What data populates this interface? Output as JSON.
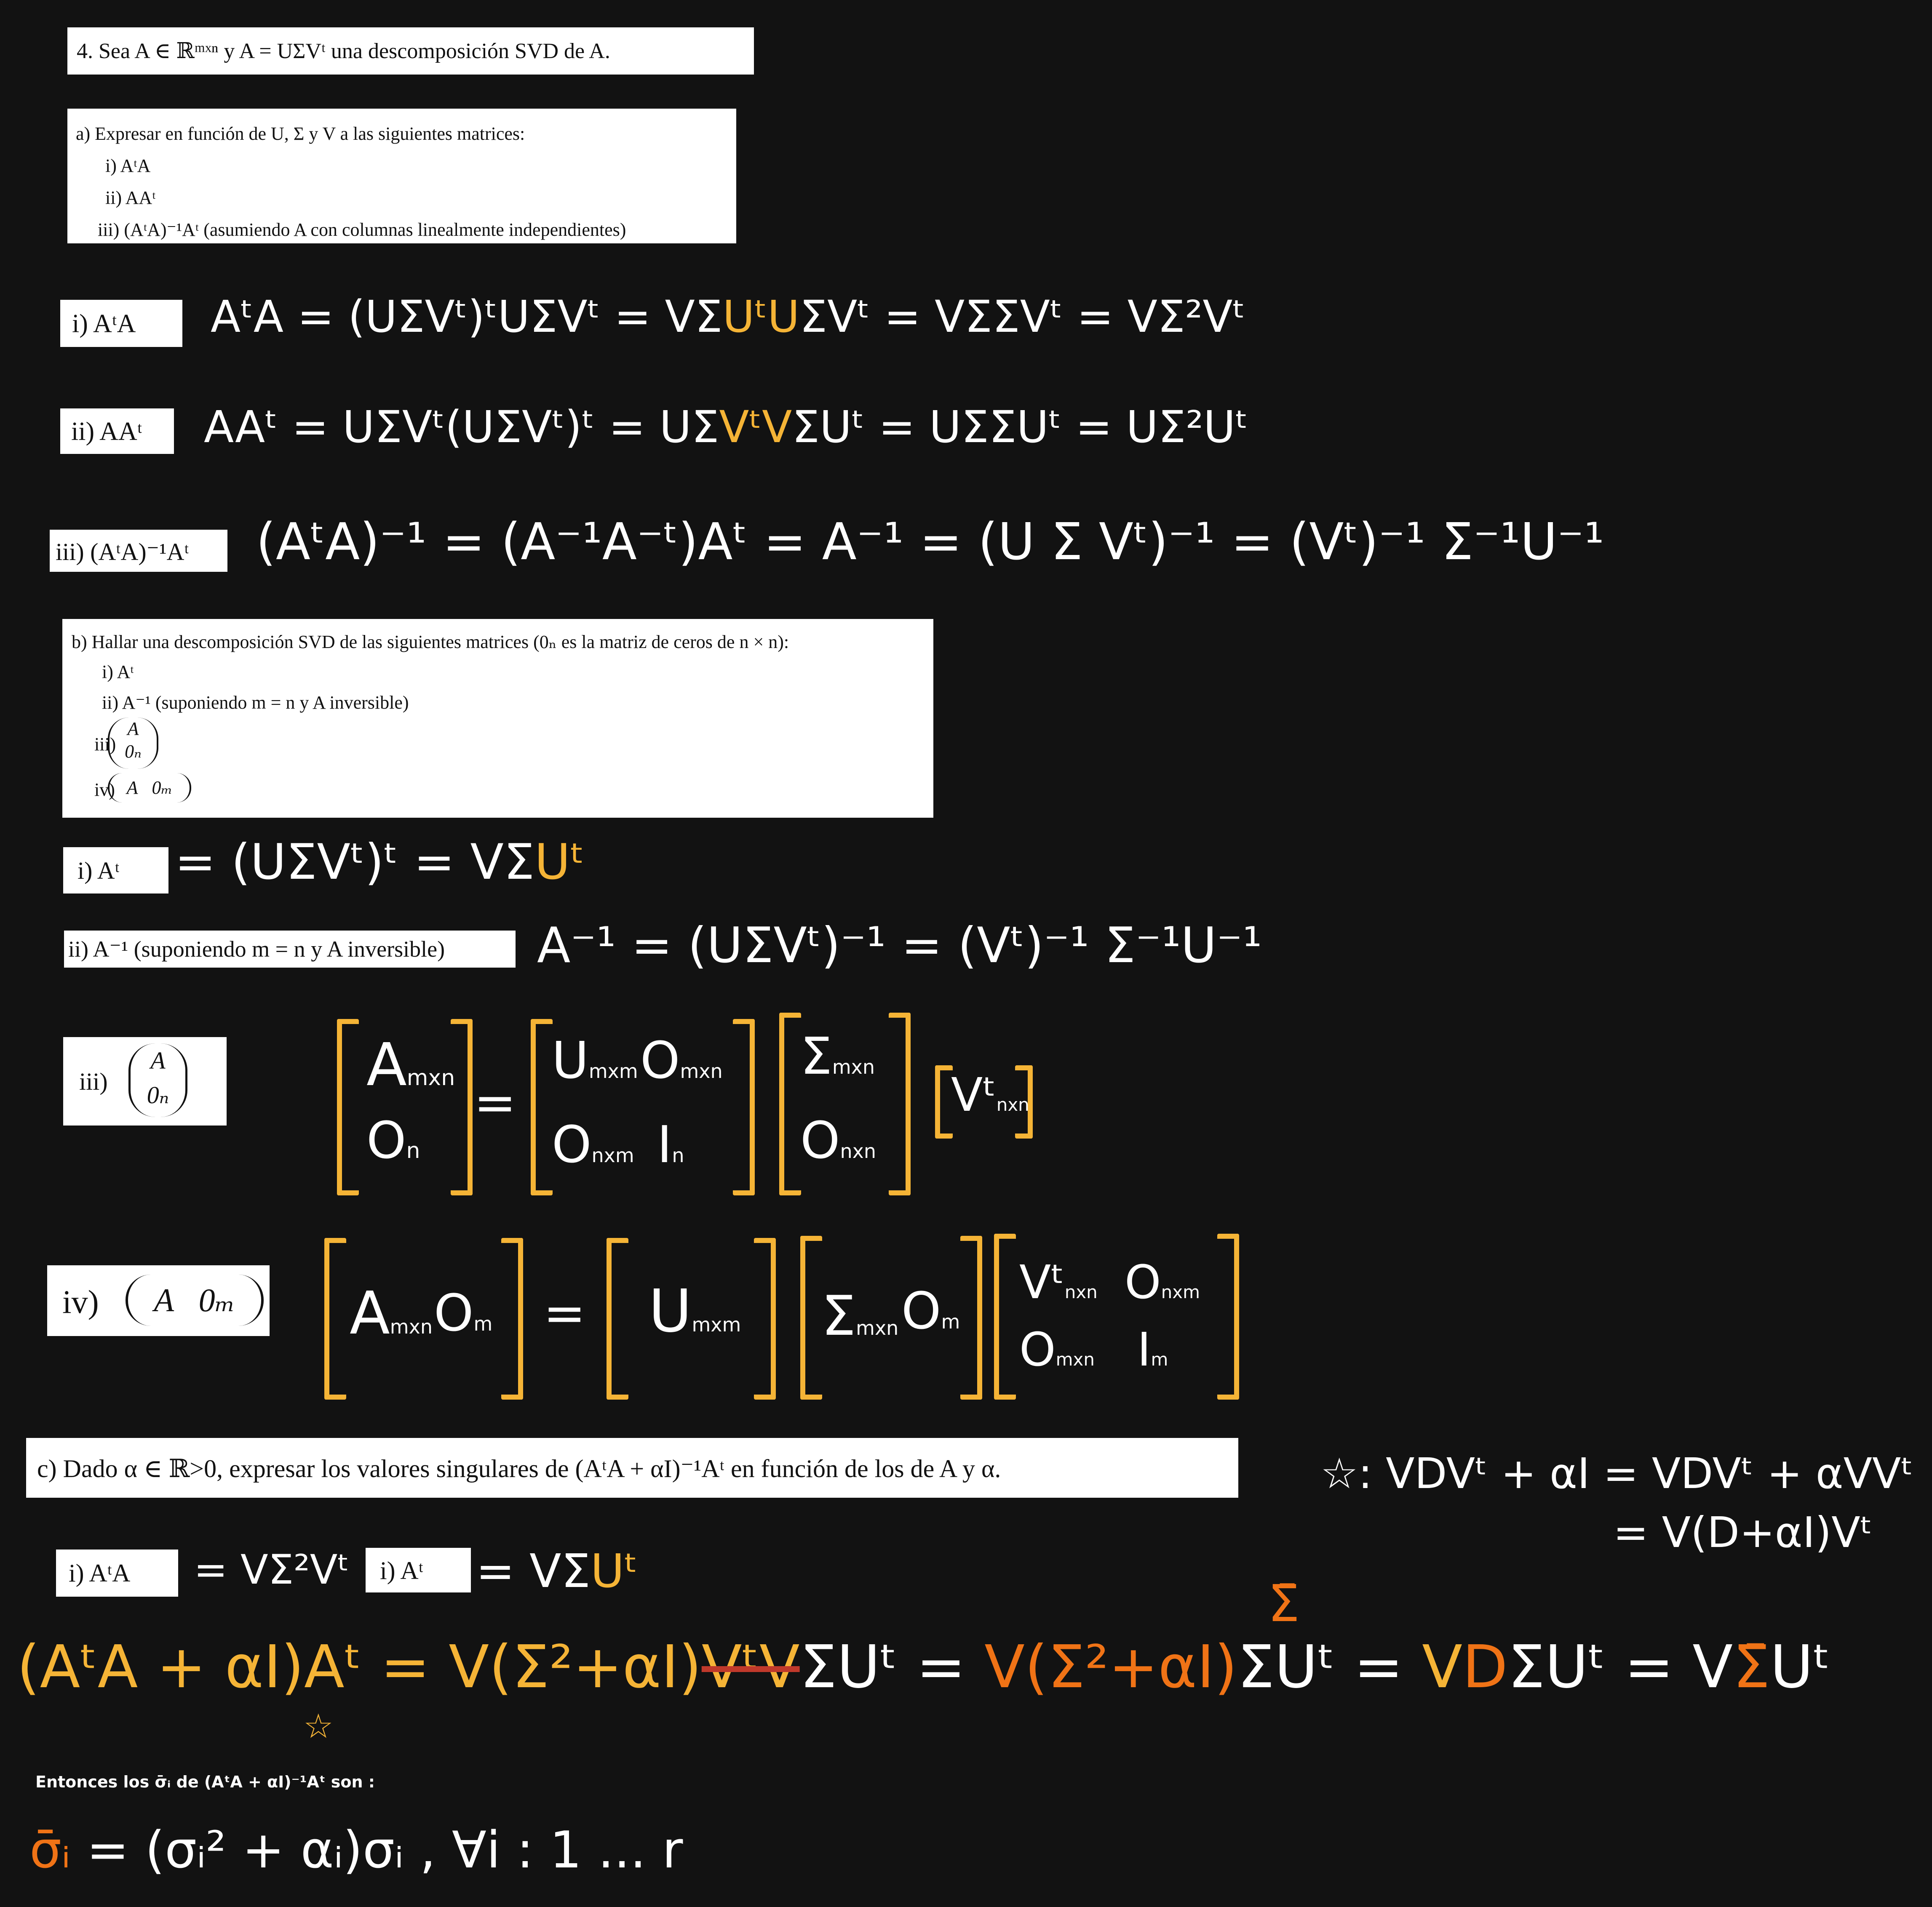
{
  "header": {
    "text": "4.  Sea A ∈ ℝᵐˣⁿ y A = UΣVᵗ una descomposición SVD de A."
  },
  "part_a": {
    "prompt": "a)  Expresar en función de U, Σ y V a las siguientes matrices:",
    "items": [
      "i)  AᵗA",
      "ii)  AAᵗ",
      "iii)  (AᵗA)⁻¹Aᵗ (asumiendo A con columnas linealmente independientes)"
    ],
    "labels": [
      "i)  AᵗA",
      "ii)  AAᵗ",
      "iii)  (AᵗA)⁻¹Aᵗ"
    ],
    "answers": {
      "i": [
        "AᵗA = (UΣVᵗ)ᵗUΣVᵗ = VΣ",
        "UᵗU",
        "ΣVᵗ = VΣΣVᵗ = VΣ²Vᵗ"
      ],
      "ii": [
        "AAᵗ = UΣVᵗ(UΣVᵗ)ᵗ = UΣ",
        "VᵗV",
        "ΣUᵗ = UΣΣUᵗ = UΣ²Uᵗ"
      ],
      "iii": "(AᵗA)⁻¹ = (A⁻¹A⁻ᵗ)Aᵗ = A⁻¹ = (U Σ Vᵗ)⁻¹ =  (Vᵗ)⁻¹ Σ⁻¹U⁻¹"
    }
  },
  "part_b": {
    "prompt": "b)  Hallar una descomposición SVD de las siguientes matrices (0ₙ es la matriz de ceros de n × n):",
    "items": [
      "i)  Aᵗ",
      "ii)  A⁻¹ (suponiendo m = n y A inversible)",
      "iii)",
      "iv)"
    ],
    "stack_top": "A",
    "stack_bottom": "0ₙ",
    "row_left": "A",
    "row_right": "0ₘ",
    "labels": [
      "i)  Aᵗ",
      "ii)  A⁻¹ (suponiendo m = n y A inversible)",
      "iii)",
      "iv)"
    ],
    "answers": {
      "i": [
        "= (UΣVᵗ)ᵗ = VΣ",
        "Uᵗ"
      ],
      "ii": "A⁻¹ = (UΣVᵗ)⁻¹ = (Vᵗ)⁻¹ Σ⁻¹U⁻¹",
      "iii": {
        "lhs_top": "A",
        "lhs_top_sub": "mxn",
        "lhs_bottom": "O",
        "lhs_bottom_sub": "n",
        "eq": "=",
        "u_tl": "U",
        "u_tl_sub": "mxm",
        "u_tr": "O",
        "u_tr_sub": "mxn",
        "u_bl": "O",
        "u_bl_sub": "nxm",
        "u_br": "I",
        "u_br_sub": "n",
        "s_top": "Σ",
        "s_top_sub": "mxn",
        "s_bottom": "O",
        "s_bottom_sub": "nxn",
        "v": "Vᵗ",
        "v_sub": "nxn"
      },
      "iv": {
        "lhs_a": "A",
        "lhs_a_sub": "mxn",
        "lhs_o": "O",
        "lhs_o_sub": "m",
        "eq": "=",
        "u": "U",
        "u_sub": "mxm",
        "s": "Σ",
        "s_sub": "mxn",
        "s_o": "O",
        "s_o_sub": "m",
        "v_tl": "Vᵗ",
        "v_tl_sub": "nxn",
        "v_tr": "O",
        "v_tr_sub": "nxm",
        "v_bl": "O",
        "v_bl_sub": "mxn",
        "v_br": "I",
        "v_br_sub": "m"
      }
    }
  },
  "part_c": {
    "prompt": "c)  Dado α ∈ ℝ>0, expresar los valores singulares de (AᵗA + αI)⁻¹Aᵗ en función de los de A y α.",
    "label_1": "i)  AᵗA",
    "label_2": "i)  Aᵗ",
    "ref_1": "= VΣ²Vᵗ",
    "ref_2a": "= VΣ",
    "ref_2b": "Uᵗ",
    "star_note_1": "☆:  VDVᵗ + αI = VDVᵗ + αVVᵗ",
    "star_note_2": "= V(D+αI)Vᵗ",
    "sigma_bar": "Σ̄",
    "main_lhs": "(AᵗA + αI)Aᵗ =",
    "main_1": "V(Σ²+αI)",
    "main_2": "VᵗV",
    "main_3": "ΣUᵗ  =",
    "main_4": "V(Σ²+αI)",
    "main_5": "ΣUᵗ =",
    "main_6": "V",
    "main_7": "D",
    "main_8": "ΣUᵗ = V",
    "main_9": "Σ̄",
    "main_10": "Uᵗ",
    "star": "☆",
    "conclusion": "Entonces los  σ̄ᵢ  de (AᵗA + αI)⁻¹Aᵗ son :",
    "final_a": "σ̄ᵢ",
    "final_b": " = (σᵢ² + αᵢ)σᵢ ,  ∀i : 1 ... r"
  }
}
